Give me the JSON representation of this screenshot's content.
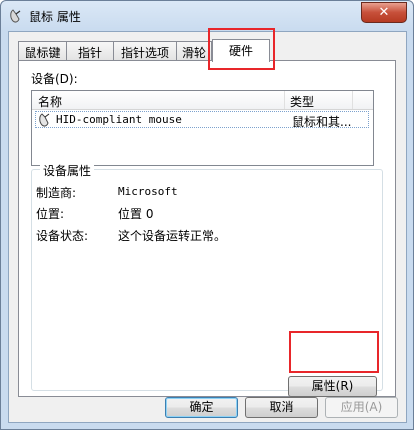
{
  "window": {
    "title": "鼠标 属性",
    "close_label": "✕"
  },
  "tabs": [
    {
      "label": "鼠标键"
    },
    {
      "label": "指针"
    },
    {
      "label": "指针选项"
    },
    {
      "label": "滑轮"
    },
    {
      "label": "硬件",
      "active": true
    }
  ],
  "devices": {
    "label": "设备(D):",
    "columns": [
      "名称",
      "类型"
    ],
    "rows": [
      {
        "name": "HID-compliant mouse",
        "type": "鼠标和其..."
      }
    ]
  },
  "properties": {
    "group_title": "设备属性",
    "items": [
      {
        "label": "制造商:",
        "value": "Microsoft"
      },
      {
        "label": "位置:",
        "value": "位置 0"
      },
      {
        "label": "设备状态:",
        "value": "这个设备运转正常。"
      }
    ],
    "button_label": "属性(R)"
  },
  "footer": {
    "ok_label": "确定",
    "cancel_label": "取消",
    "apply_label": "应用(A)"
  },
  "colors": {
    "highlight": "#e8262a",
    "close_button": "#c7503a"
  }
}
